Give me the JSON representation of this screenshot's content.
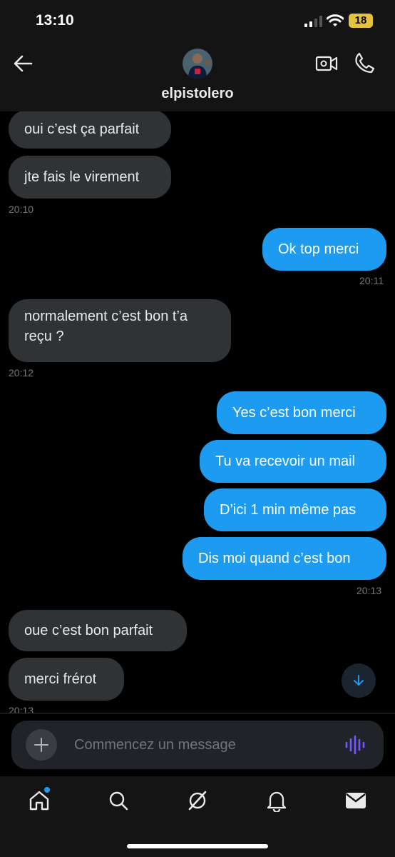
{
  "status_bar": {
    "time": "13:10",
    "battery": "18",
    "icons": [
      "signal-icon",
      "wifi-icon",
      "battery-icon"
    ],
    "battery_color": "#e5c23b"
  },
  "header": {
    "contact_name": "elpistolero",
    "icons": [
      "back-arrow-icon",
      "avatar",
      "video-call-icon",
      "phone-call-icon"
    ]
  },
  "messages": [
    {
      "side": "in",
      "text": "oui c’est ça parfait"
    },
    {
      "side": "in",
      "text": "jte fais le virement",
      "time": "20:10"
    },
    {
      "side": "out",
      "text": "Ok top merci",
      "time": "20:11"
    },
    {
      "side": "in",
      "text": "normalement c’est bon t’a reçu ?",
      "time": "20:12"
    },
    {
      "side": "out",
      "text": "Yes c’est bon merci"
    },
    {
      "side": "out",
      "text": "Tu va recevoir un mail"
    },
    {
      "side": "out",
      "text": "D’ici 1 min même pas"
    },
    {
      "side": "out",
      "text": "Dis moi quand c’est bon",
      "time": "20:13"
    },
    {
      "side": "in",
      "text": "oue c’est bon parfait"
    },
    {
      "side": "in",
      "text": "merci frérot",
      "time": "20:13"
    }
  ],
  "composer": {
    "placeholder": "Commencez un message",
    "icons": [
      "plus-icon",
      "voice-message-icon"
    ]
  },
  "bottom_nav": {
    "items": [
      "home-icon",
      "search-icon",
      "grok-icon",
      "notifications-icon",
      "messages-icon"
    ],
    "active": "messages-icon"
  },
  "colors": {
    "accent": "#1d9bf0",
    "incoming_bubble": "#2f3336",
    "background": "#000000",
    "voice_icon": "#7856ff"
  }
}
